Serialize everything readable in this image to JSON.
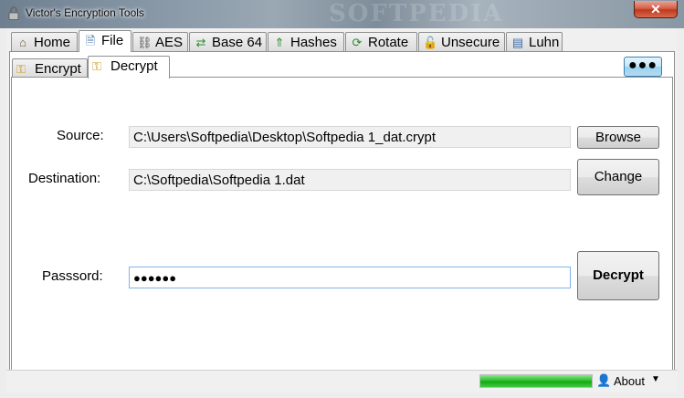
{
  "window": {
    "title": "Victor's Encryption Tools",
    "watermark": "SOFTPEDIA",
    "close_glyph": "✕"
  },
  "main_tabs": [
    {
      "label": "Home",
      "icon": "house-icon",
      "glyph": "⌂"
    },
    {
      "label": "File",
      "icon": "file-icon",
      "glyph": "🗎"
    },
    {
      "label": "AES",
      "icon": "chain-icon",
      "glyph": "⛓"
    },
    {
      "label": "Base 64",
      "icon": "shuffle-icon",
      "glyph": "⇄"
    },
    {
      "label": "Hashes",
      "icon": "hash-icon",
      "glyph": "⇑"
    },
    {
      "label": "Rotate",
      "icon": "rotate-icon",
      "glyph": "⟳"
    },
    {
      "label": "Unsecure",
      "icon": "padlock-open-icon",
      "glyph": "🔓"
    },
    {
      "label": "Luhn",
      "icon": "card-icon",
      "glyph": "▤"
    }
  ],
  "sub_tabs": [
    {
      "label": "Encrypt",
      "icon": "key-icon",
      "glyph": "⚿"
    },
    {
      "label": "Decrypt",
      "icon": "key-icon",
      "glyph": "⚿"
    }
  ],
  "more_button": {
    "label": "●●●"
  },
  "form": {
    "source_label": "Source:",
    "source_value": "C:\\Users\\Softpedia\\Desktop\\Softpedia 1_dat.crypt",
    "browse_label": "Browse",
    "destination_label": "Destination:",
    "destination_value": "C:\\Softpedia\\Softpedia 1.dat",
    "change_label": "Change",
    "password_label": "Passsord:",
    "password_value": "●●●●●●",
    "decrypt_label": "Decrypt"
  },
  "status": {
    "progress_percent": 100,
    "about_label": "About",
    "about_caret": "▼",
    "about_glyph": "👤"
  },
  "colors": {
    "progress": "#1fb51f",
    "more_button": "#98d1ef",
    "close_button": "#c1381d"
  }
}
